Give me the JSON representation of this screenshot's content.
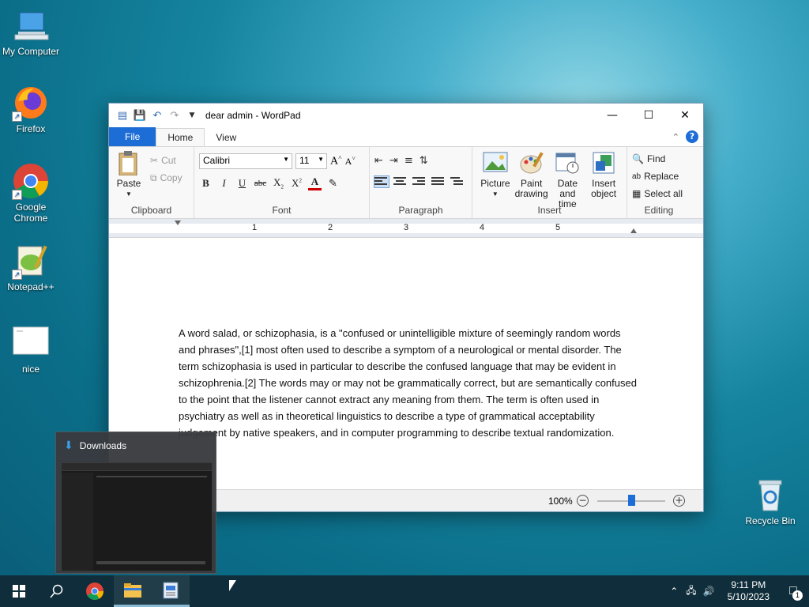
{
  "desktop": {
    "icons": [
      {
        "label": "My Computer"
      },
      {
        "label": "Firefox"
      },
      {
        "label": "Google Chrome"
      },
      {
        "label": "Notepad++"
      },
      {
        "label": "nice"
      },
      {
        "label": "Recycle Bin"
      }
    ]
  },
  "window": {
    "title": "dear admin - WordPad",
    "tabs": {
      "file": "File",
      "home": "Home",
      "view": "View"
    },
    "clipboard": {
      "paste": "Paste",
      "cut": "Cut",
      "copy": "Copy",
      "label": "Clipboard"
    },
    "font": {
      "family": "Calibri",
      "size": "11",
      "label": "Font"
    },
    "paragraph": {
      "label": "Paragraph"
    },
    "insert": {
      "picture": "Picture",
      "paint": "Paint drawing",
      "datetime": "Date and time",
      "object": "Insert object",
      "label": "Insert"
    },
    "editing": {
      "find": "Find",
      "replace": "Replace",
      "select_all": "Select all",
      "label": "Editing"
    },
    "ruler": {
      "numbers": [
        "1",
        "2",
        "3",
        "4",
        "5"
      ]
    },
    "document": {
      "paragraphs": [
        "A word salad, or schizophasia, is a \"confused or unintelligible mixture of seemingly random words and phrases\",[1] most often used to describe a symptom of a neurological or mental disorder. The term schizophasia is used in particular to describe the confused language that may be evident in schizophrenia.[2] The words may or may not be grammatically correct, but are semantically confused to the point that the listener cannot extract any meaning from them. The term is often used in psychiatry as well as in theoretical linguistics to describe a type of grammatical acceptability judgement by native speakers, and in computer programming to describe textual randomization."
      ]
    },
    "status": {
      "zoom": "100%",
      "zoom_level": 0.5
    }
  },
  "preview": {
    "title": "Downloads"
  },
  "taskbar": {
    "time": "9:11 PM",
    "date": "5/10/2023",
    "notifications": "1"
  },
  "colors": {
    "accent": "#1c6ed6",
    "taskbar": "#0f2d3a"
  }
}
